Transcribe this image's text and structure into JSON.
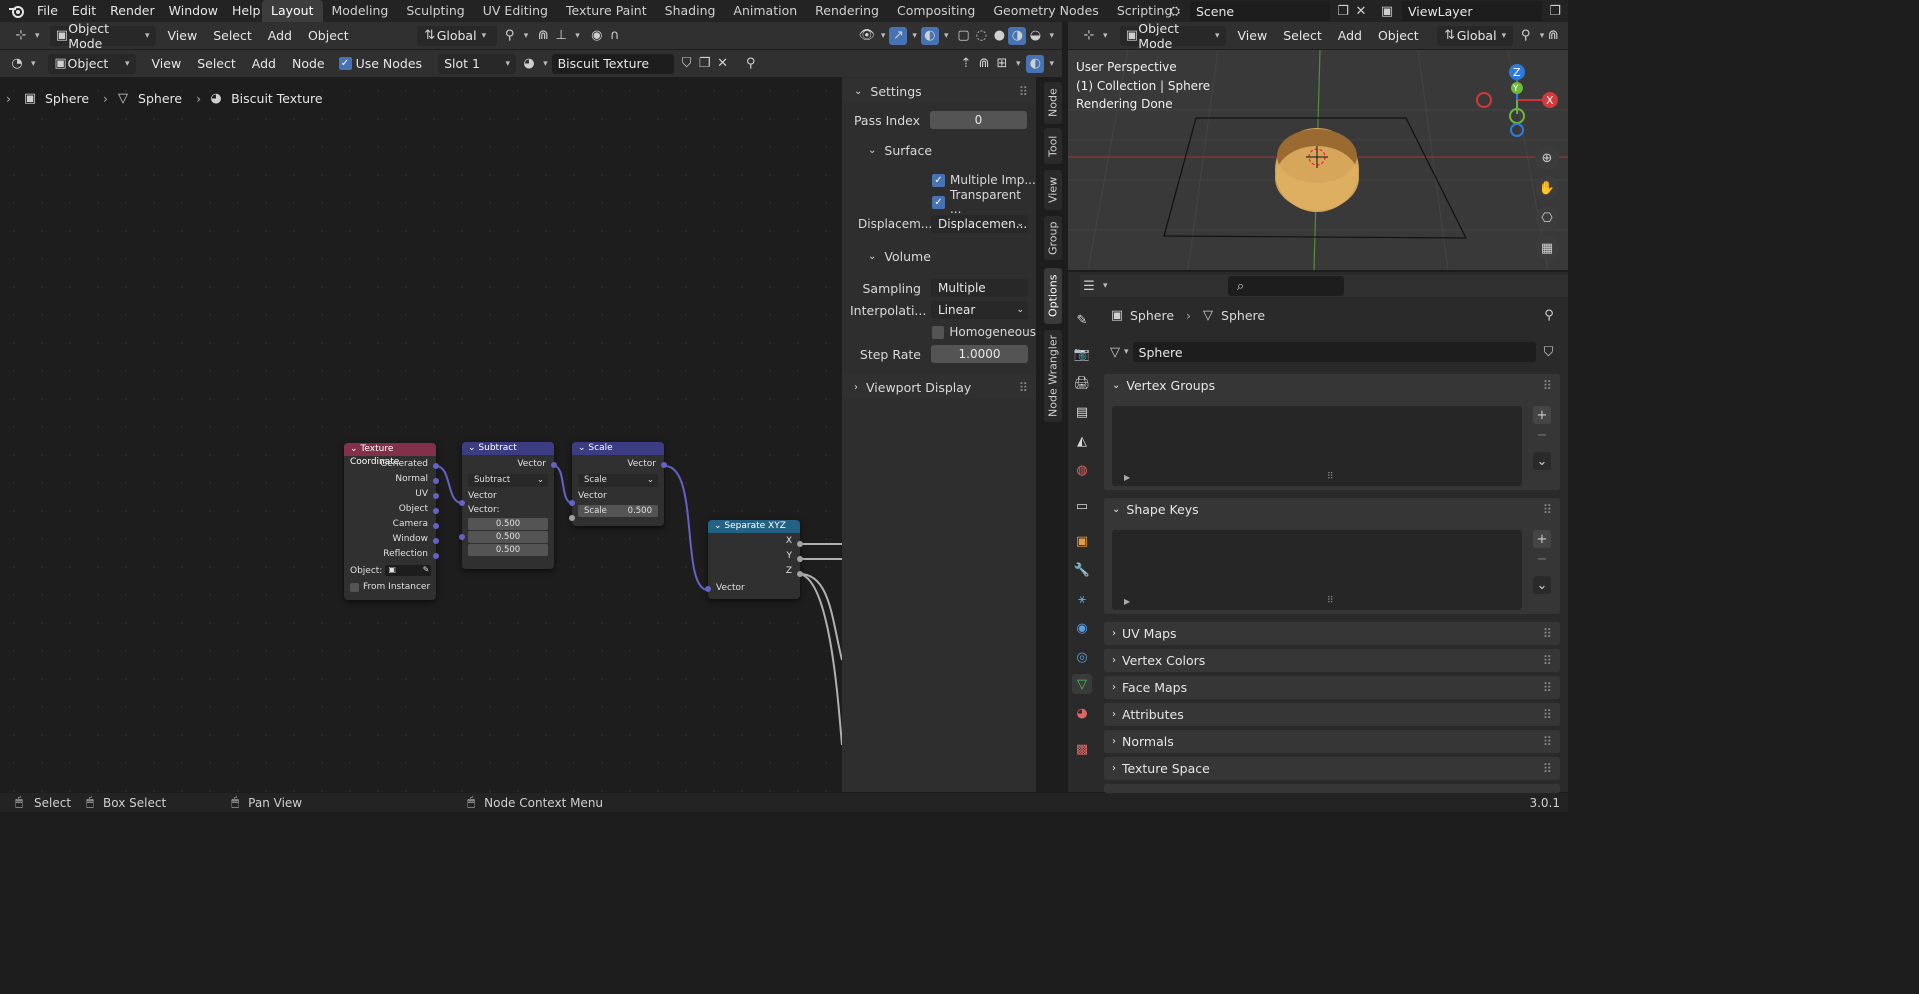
{
  "menu": [
    "File",
    "Edit",
    "Render",
    "Window",
    "Help"
  ],
  "workspaces": [
    "Layout",
    "Modeling",
    "Sculpting",
    "UV Editing",
    "Texture Paint",
    "Shading",
    "Animation",
    "Rendering",
    "Compositing",
    "Geometry Nodes",
    "Scripting"
  ],
  "active_workspace": "Layout",
  "scene": "Scene",
  "view_layer": "ViewLayer",
  "header": {
    "mode": "Object Mode",
    "menus": [
      "View",
      "Select",
      "Add",
      "Object"
    ],
    "orientation": "Global"
  },
  "node_header": {
    "type": "Object",
    "menus": [
      "View",
      "Select",
      "Add",
      "Node"
    ],
    "use_nodes": "Use Nodes",
    "slot": "Slot 1",
    "material": "Biscuit Texture"
  },
  "breadcrumb": [
    "Sphere",
    "Sphere",
    "Biscuit Texture"
  ],
  "nodes": {
    "texcoord": {
      "title": "Texture Coordinate",
      "outputs": [
        "Generated",
        "Normal",
        "UV",
        "Object",
        "Camera",
        "Window",
        "Reflection"
      ],
      "object_label": "Object:",
      "from_instancer": "From Instancer"
    },
    "subtract": {
      "title": "Subtract",
      "out": "Vector",
      "op": "Subtract",
      "in": "Vector",
      "vlabel": "Vector:",
      "values": [
        "0.500",
        "0.500",
        "0.500"
      ]
    },
    "scale": {
      "title": "Scale",
      "out": "Vector",
      "op": "Scale",
      "in": "Vector",
      "scale_label": "Scale",
      "scale_value": "0.500"
    },
    "sepxyz": {
      "title": "Separate XYZ",
      "outs": [
        "X",
        "Y",
        "Z"
      ],
      "in": "Vector"
    }
  },
  "npanel": {
    "settings": "Settings",
    "pass_index_label": "Pass Index",
    "pass_index": "0",
    "surface": "Surface",
    "multiple_imp": "Multiple Imp...",
    "transparent": "Transparent ...",
    "displacement_label": "Displacem...",
    "displacement": "Displacemen...",
    "volume": "Volume",
    "sampling_label": "Sampling",
    "sampling": "Multiple Impo...",
    "interp_label": "Interpolati...",
    "interp": "Linear",
    "homogeneous": "Homogeneous",
    "step_label": "Step Rate",
    "step": "1.0000",
    "viewport_display": "Viewport Display",
    "tabs": [
      "Node",
      "Tool",
      "View",
      "Group",
      "Options",
      "Node Wrangler"
    ]
  },
  "viewport": {
    "mode": "Object Mode",
    "menus": [
      "View",
      "Select",
      "Add",
      "Object"
    ],
    "orientation": "Global",
    "info": [
      "User Perspective",
      "(1) Collection | Sphere",
      "Rendering Done"
    ],
    "axes": [
      "Z",
      "Y",
      "X"
    ]
  },
  "properties": {
    "breadcrumb": [
      "Sphere",
      "Sphere"
    ],
    "mesh_name": "Sphere",
    "sections_open": [
      "Vertex Groups",
      "Shape Keys"
    ],
    "sections_closed": [
      "UV Maps",
      "Vertex Colors",
      "Face Maps",
      "Attributes",
      "Normals",
      "Texture Space"
    ]
  },
  "status": {
    "select": "Select",
    "box_select": "Box Select",
    "pan_view": "Pan View",
    "context_menu": "Node Context Menu",
    "version": "3.0.1"
  },
  "colors": {
    "accent": "#4772b3",
    "texcoord_header": "#83314a",
    "vector_header": "#3c3c83",
    "converter_header": "#246283",
    "vector_socket": "#6363c7"
  }
}
